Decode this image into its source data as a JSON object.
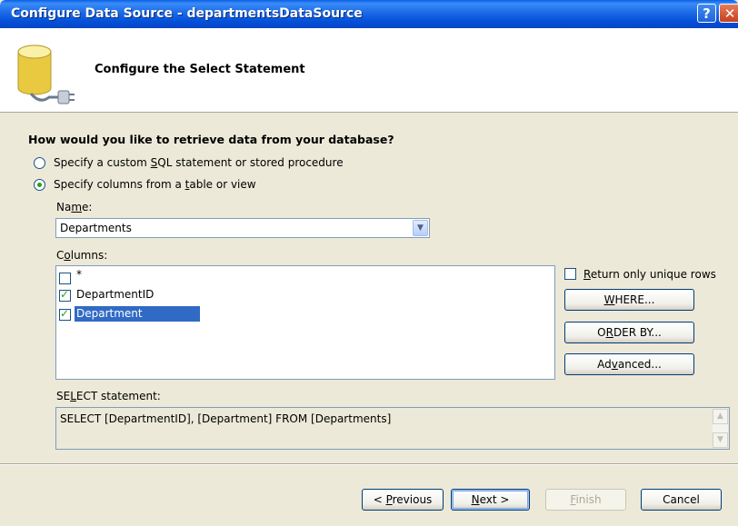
{
  "window": {
    "title": "Configure Data Source - departmentsDataSource"
  },
  "header": {
    "title": "Configure the Select Statement",
    "icon": "database-icon"
  },
  "question": "How would you like to retrieve data from your database?",
  "options": [
    {
      "pre": "Specify a custom ",
      "u": "S",
      "post": "QL statement or stored procedure",
      "selected": false
    },
    {
      "pre": "Specify columns from a ",
      "u": "t",
      "post": "able or view",
      "selected": true
    }
  ],
  "name_label": {
    "pre": "Na",
    "u": "m",
    "post": "e:"
  },
  "table_select": {
    "value": "Departments"
  },
  "columns_label": {
    "pre": "C",
    "u": "o",
    "post": "lumns:"
  },
  "columns": [
    {
      "label": "*",
      "checked": false,
      "selected": false
    },
    {
      "label": "DepartmentID",
      "checked": true,
      "selected": false
    },
    {
      "label": "Department",
      "checked": true,
      "selected": true
    }
  ],
  "unique_rows": {
    "pre": "",
    "u": "R",
    "post": "eturn only unique rows",
    "checked": false
  },
  "buttons": {
    "where": {
      "pre": "",
      "u": "W",
      "post": "HERE..."
    },
    "orderby": {
      "pre": "O",
      "u": "R",
      "post": "DER BY..."
    },
    "advanced": {
      "pre": "Ad",
      "u": "v",
      "post": "anced..."
    }
  },
  "select_label": {
    "pre": "SE",
    "u": "L",
    "post": "ECT statement:"
  },
  "select_statement": "SELECT [DepartmentID], [Department] FROM [Departments]",
  "footer": {
    "previous": {
      "pre": "< ",
      "u": "P",
      "post": "revious"
    },
    "next": {
      "pre": "",
      "u": "N",
      "post": "ext >"
    },
    "finish": {
      "pre": "",
      "u": "F",
      "post": "inish"
    },
    "cancel": "Cancel"
  },
  "colors": {
    "title_bar": "#0a5fe6",
    "selection": "#316ac5",
    "dialog": "#ece9d8"
  }
}
